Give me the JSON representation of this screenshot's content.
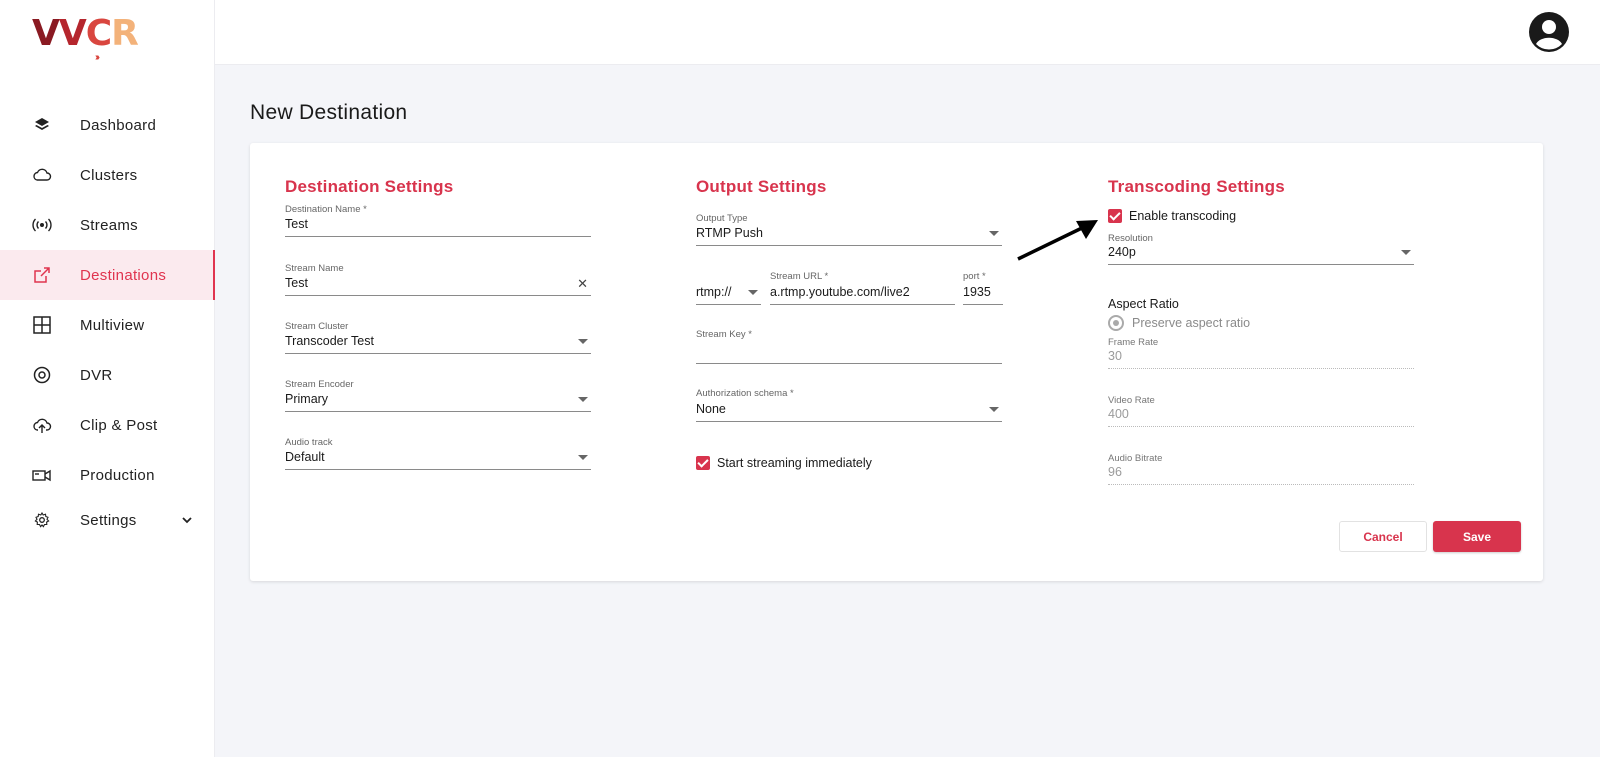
{
  "logo": {
    "letters": [
      "V",
      "V",
      "C",
      "R"
    ],
    "chevrons": "››››››"
  },
  "sidebar": {
    "items": [
      {
        "label": "Dashboard",
        "icon": "layers-icon"
      },
      {
        "label": "Clusters",
        "icon": "cloud-icon"
      },
      {
        "label": "Streams",
        "icon": "broadcast-icon"
      },
      {
        "label": "Destinations",
        "icon": "external-link-icon",
        "active": true
      },
      {
        "label": "Multiview",
        "icon": "grid-icon"
      },
      {
        "label": "DVR",
        "icon": "disc-icon"
      },
      {
        "label": "Clip & Post",
        "icon": "cloud-upload-icon"
      },
      {
        "label": "Production",
        "icon": "video-camera-icon"
      },
      {
        "label": "Settings",
        "icon": "gear-icon",
        "expandable": true
      }
    ]
  },
  "header": {
    "avatar_icon": "user-avatar-icon"
  },
  "page": {
    "title": "New Destination"
  },
  "destination": {
    "title": "Destination Settings",
    "name_label": "Destination Name *",
    "name_value": "Test",
    "stream_name_label": "Stream Name",
    "stream_name_value": "Test",
    "clear_glyph": "✕",
    "cluster_label": "Stream Cluster",
    "cluster_value": "Transcoder Test",
    "encoder_label": "Stream Encoder",
    "encoder_value": "Primary",
    "audio_label": "Audio track",
    "audio_value": "Default"
  },
  "output": {
    "title": "Output Settings",
    "type_label": "Output Type",
    "type_value": "RTMP Push",
    "protocol_value": "rtmp://",
    "url_label": "Stream URL *",
    "url_value": "a.rtmp.youtube.com/live2",
    "port_label": "port *",
    "port_value": "1935",
    "key_label": "Stream Key *",
    "key_value": "",
    "auth_label": "Authorization schema *",
    "auth_value": "None",
    "start_label": "Start streaming immediately",
    "start_checked": true
  },
  "transcoding": {
    "title": "Transcoding Settings",
    "enable_label": "Enable transcoding",
    "enable_checked": true,
    "resolution_label": "Resolution",
    "resolution_value": "240p",
    "aspect_title": "Aspect Ratio",
    "preserve_label": "Preserve aspect ratio",
    "frame_rate_label": "Frame Rate",
    "frame_rate_value": "30",
    "video_rate_label": "Video Rate",
    "video_rate_value": "400",
    "audio_bitrate_label": "Audio Bitrate",
    "audio_bitrate_value": "96"
  },
  "actions": {
    "cancel": "Cancel",
    "save": "Save"
  },
  "colors": {
    "accent": "#d8344d",
    "active_bg": "#fbeaee",
    "page_bg": "#f4f5f9"
  }
}
